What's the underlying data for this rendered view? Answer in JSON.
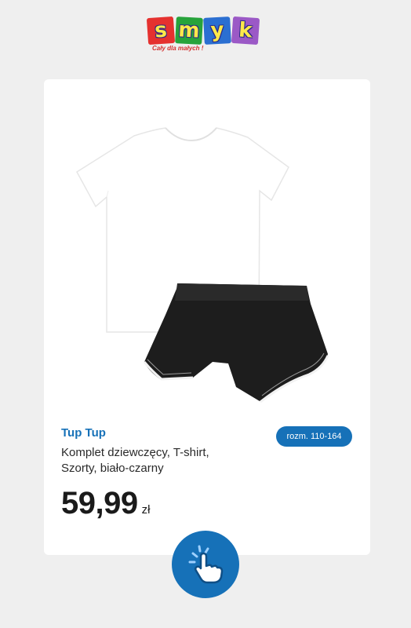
{
  "logo": {
    "letters": [
      "s",
      "m",
      "y",
      "k"
    ],
    "tagline": "Cały dla małych !"
  },
  "product": {
    "brand": "Tup Tup",
    "description": "Komplet dziewczęcy, T-shirt, Szorty, biało-czarny",
    "size_badge": "rozm. 110-164",
    "price_value": "59,99",
    "price_currency": "zł"
  },
  "icons": {
    "click_button": "hand-pointer-icon",
    "product_image": "tshirt-shorts-set-image"
  },
  "colors": {
    "accent": "#1671b8",
    "background": "#efefef",
    "card": "#ffffff",
    "logo_tile_1": "#e5312f",
    "logo_tile_2": "#27a33b",
    "logo_tile_3": "#2b6fd1",
    "logo_tile_4": "#9b59c6"
  }
}
